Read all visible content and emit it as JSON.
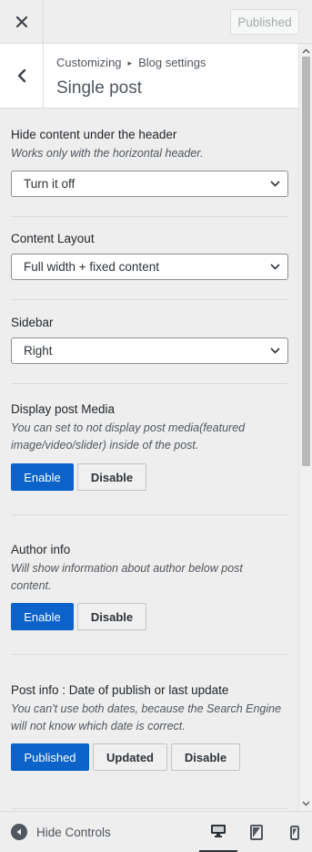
{
  "header": {
    "close_icon": "close-icon",
    "publish_label": "Published"
  },
  "section": {
    "back_icon": "chevron-left-icon",
    "breadcrumb_root": "Customizing",
    "breadcrumb_separator": "▸",
    "breadcrumb_parent": "Blog settings",
    "title": "Single post"
  },
  "controls": {
    "hide_content": {
      "title": "Hide content under the header",
      "description": "Works only with the horizontal header.",
      "value": "Turn it off"
    },
    "content_layout": {
      "title": "Content Layout",
      "value": "Full width + fixed content"
    },
    "sidebar": {
      "title": "Sidebar",
      "value": "Right"
    },
    "post_media": {
      "title": "Display post Media",
      "description_line1": "You can set to not display post media(featured",
      "description_line2": "image/video/slider) inside of the post.",
      "enable_label": "Enable",
      "disable_label": "Disable",
      "selected": "Enable"
    },
    "author_info": {
      "title": "Author info",
      "description_line1": "Will show information about author below post",
      "description_line2": "content.",
      "enable_label": "Enable",
      "disable_label": "Disable",
      "selected": "Enable"
    },
    "post_info": {
      "title": "Post info : Date of publish or last update",
      "description_line1": "You can't use both dates, because the Search Engine",
      "description_line2": "will not know which date is correct.",
      "published_label": "Published",
      "updated_label": "Updated",
      "disable_label": "Disable",
      "selected": "Published"
    }
  },
  "footer": {
    "hide_controls_label": "Hide Controls",
    "devices": [
      "desktop",
      "tablet",
      "mobile"
    ],
    "active_device": "desktop"
  },
  "colors": {
    "accent": "#0b62c8",
    "panel_bg": "#eeeeee",
    "border": "#dddddd"
  }
}
